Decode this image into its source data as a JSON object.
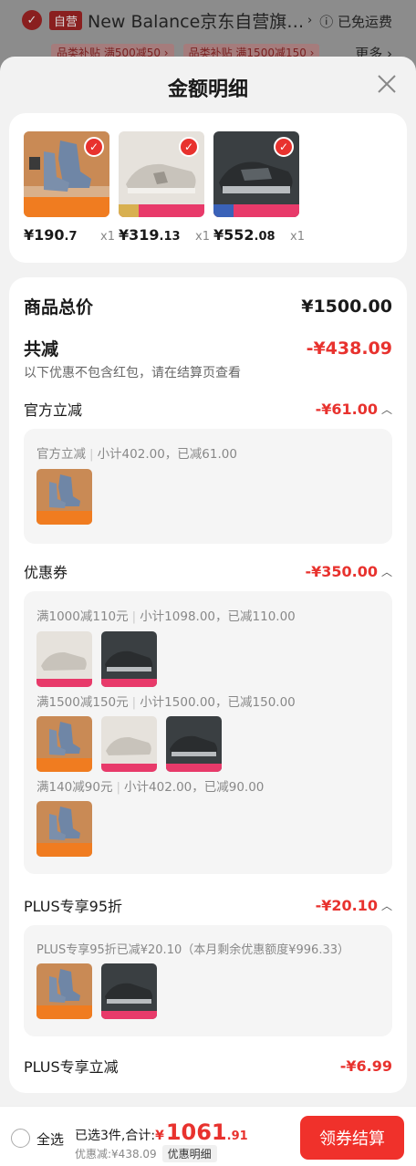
{
  "store": {
    "self_tag": "自营",
    "name": "New Balance京东自营旗…",
    "free_shipping": "已免运费",
    "subsidy_tags": [
      "品类补贴 满500减50 ›",
      "品类补贴 满1500减150 ›"
    ],
    "more": "更多 ›"
  },
  "sheet": {
    "title": "金额明细"
  },
  "products": [
    {
      "price": "¥190",
      "price_dec": ".7",
      "qty": "x1"
    },
    {
      "price": "¥319",
      "price_dec": ".13",
      "qty": "x1"
    },
    {
      "price": "¥552",
      "price_dec": ".08",
      "qty": "x1"
    }
  ],
  "summary": {
    "total_label": "商品总价",
    "total_value": "¥1500.00",
    "discount_label": "共减",
    "discount_value": "-¥438.09",
    "hint": "以下优惠不包含红包，请在结算页查看"
  },
  "sections": {
    "official": {
      "label": "官方立减",
      "value": "-¥61.00",
      "lines": [
        {
          "a": "官方立减",
          "b": "小计402.00，已减61.00"
        }
      ]
    },
    "coupon": {
      "label": "优惠券",
      "value": "-¥350.00",
      "lines": [
        {
          "a": "满1000减110元",
          "b": "小计1098.00，已减110.00"
        },
        {
          "a": "满1500减150元",
          "b": "小计1500.00，已减150.00"
        },
        {
          "a": "满140减90元",
          "b": "小计402.00，已减90.00"
        }
      ]
    },
    "plus95": {
      "label": "PLUS专享95折",
      "value": "-¥20.10",
      "lines": [
        {
          "a": "PLUS专享95折已减¥20.10（本月剩余优惠额度¥996.33）"
        }
      ]
    },
    "plus_direct": {
      "label": "PLUS专享立减",
      "value": "-¥6.99"
    }
  },
  "bottom": {
    "select_all": "全选",
    "selected_text": "已选3件,合计:",
    "currency": "¥",
    "amount_int": "1061",
    "amount_dec": ".91",
    "saved_text": "优惠减:¥438.09",
    "detail_chip": "优惠明细",
    "checkout": "领券结算"
  },
  "colors": {
    "accent": "#e8322e",
    "sheet_bg": "#f2f2f2"
  }
}
